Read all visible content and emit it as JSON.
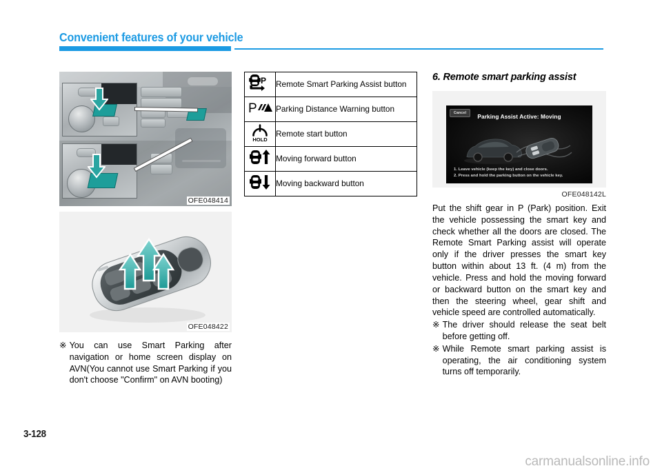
{
  "header": {
    "title": "Convenient features of your vehicle",
    "accent_color": "#1b9ae3"
  },
  "page_number": "3-128",
  "watermark": "carmanualsonline.info",
  "left_column": {
    "figure_console_caption": "OFE048414",
    "figure_key_caption": "OFE048422",
    "note_mark": "※",
    "note_text": "You can use Smart Parking after navigation or home screen display on AVN(You cannot use Smart Parking if you don't choose \"Confirm\" on AVN booting)"
  },
  "middle_column": {
    "table_rows": [
      {
        "icon": "car-parking-p-icon",
        "label": "Remote Smart Parking Assist button"
      },
      {
        "icon": "parking-distance-warning-icon",
        "label": "Parking Distance Warning button"
      },
      {
        "icon": "remote-start-hold-icon",
        "label": "Remote start button"
      },
      {
        "icon": "car-arrow-up-icon",
        "label": "Moving forward button"
      },
      {
        "icon": "car-arrow-down-icon",
        "label": "Moving backward button"
      }
    ]
  },
  "right_column": {
    "heading": "6. Remote smart parking assist",
    "figure_caption": "OFE048142L",
    "nav_screen": {
      "cancel_label": "Cancel",
      "title": "Parking Assist Active: Moving",
      "step_1": "1. Leave vehicle (keep the key) and close doors.",
      "step_2": "2. Press and hold the parking button on the vehicle key."
    },
    "body_text": "Put the shift gear in P (Park) position. Exit the vehicle possessing the smart key and check whether all the doors are closed. The Remote Smart Parking assist will operate only if the driver presses the smart key button within about 13 ft. (4 m) from the vehicle. Press and hold the moving forward or backward button on the smart key and then the steering wheel, gear shift and vehicle speed are controlled automatically.",
    "notes": [
      {
        "mark": "※",
        "text": "The driver should release the seat belt before getting off."
      },
      {
        "mark": "※",
        "text": "While Remote smart parking assist is operating, the air conditioning system turns off temporarily."
      }
    ]
  }
}
